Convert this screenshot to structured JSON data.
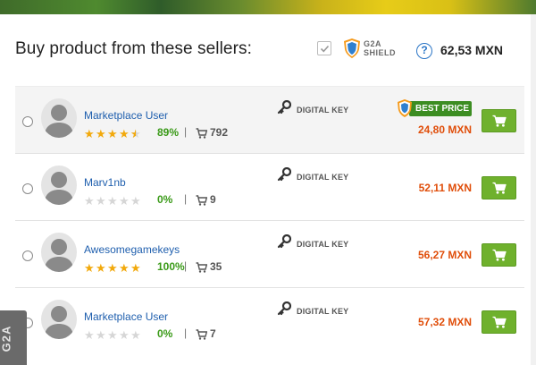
{
  "header": {
    "title": "Buy product from these sellers:",
    "shield_name_line1": "G2A",
    "shield_name_line2": "SHIELD",
    "help_symbol": "?",
    "shield_price": "62,53 MXN"
  },
  "colors": {
    "link": "#1f5fae",
    "price": "#e04e0a",
    "positive": "#3a9a18",
    "cart_button": "#6fb12d",
    "star": "#f2a90c"
  },
  "icons": {
    "shield_checkbox": "checkmark-icon",
    "shield_logo": "g2a-shield-icon",
    "help": "question-circle-icon",
    "key": "key-icon",
    "cart": "shopping-cart-icon",
    "avatar": "default-user-avatar-icon"
  },
  "badge": {
    "label": "BEST PRICE"
  },
  "sellers": [
    {
      "name": "Marketplace User",
      "stars": 4.5,
      "percent": "89%",
      "separator": "|",
      "sales": "792",
      "product_type": "DIGITAL KEY",
      "best_price": true,
      "price": "24,80 MXN",
      "selected": false
    },
    {
      "name": "Marv1nb",
      "stars": 0,
      "percent": "0%",
      "separator": "|",
      "sales": "9",
      "product_type": "DIGITAL KEY",
      "best_price": false,
      "price": "52,11 MXN",
      "selected": false
    },
    {
      "name": "Awesomegamekeys",
      "stars": 5,
      "percent": "100%",
      "separator": "|",
      "sales": "35",
      "product_type": "DIGITAL KEY",
      "best_price": false,
      "price": "56,27 MXN",
      "selected": false
    },
    {
      "name": "Marketplace User",
      "stars": 0,
      "percent": "0%",
      "separator": "|",
      "sales": "7",
      "product_type": "DIGITAL KEY",
      "best_price": false,
      "price": "57,32 MXN",
      "selected": false
    }
  ],
  "side_tab": {
    "label": "G2A"
  }
}
